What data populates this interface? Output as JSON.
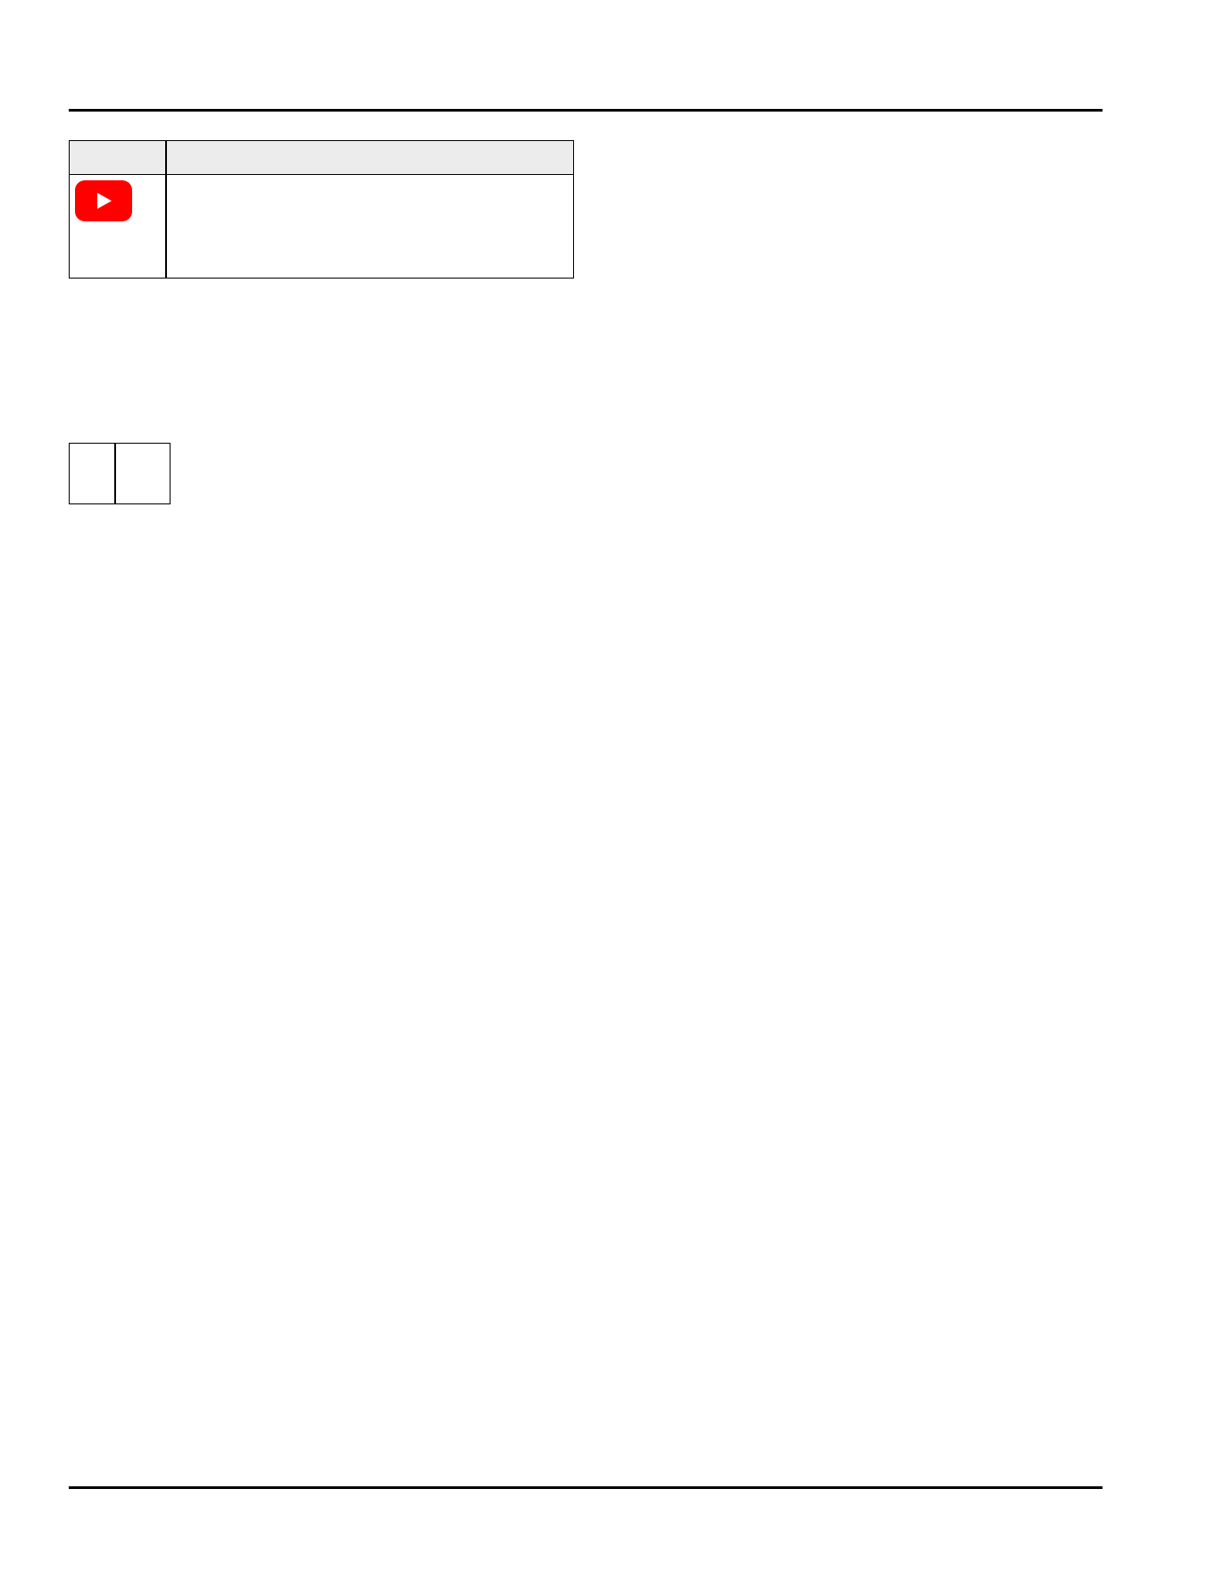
{
  "header": {},
  "media_table": {
    "col_headers": [
      "",
      ""
    ],
    "rows": [
      {
        "icon": "youtube-play-icon",
        "text": ""
      }
    ]
  },
  "small_table": {
    "cells": [
      "",
      ""
    ]
  },
  "footer": {},
  "colors": {
    "youtube_red": "#ff0000",
    "header_gray": "#ececec",
    "rule": "#000000"
  }
}
